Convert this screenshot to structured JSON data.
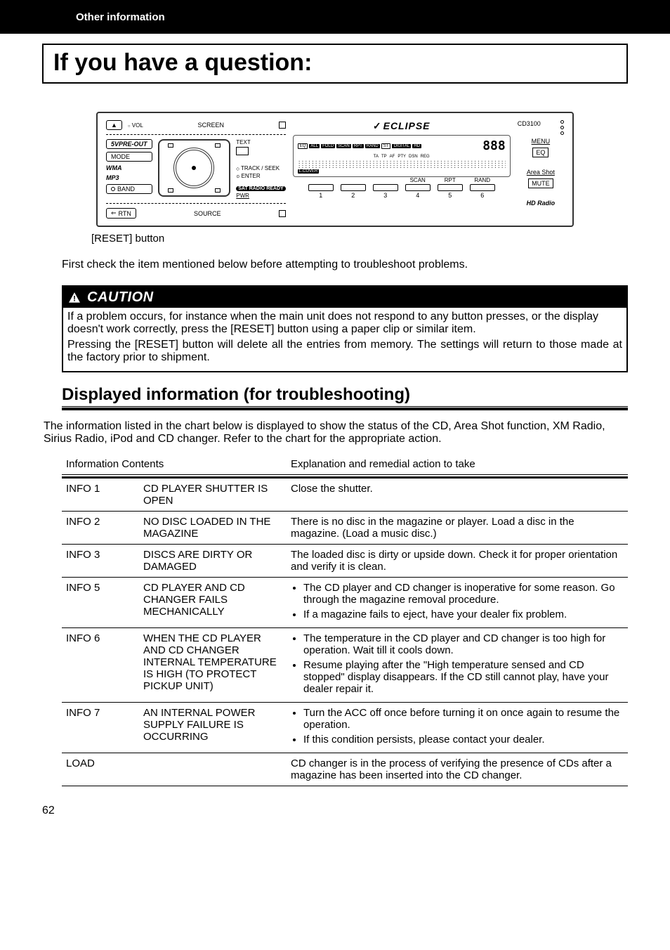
{
  "header": {
    "section": "Other information"
  },
  "title": "If you have a question:",
  "device": {
    "eject_icon": "▲",
    "vol": "VOL",
    "screen": "SCREEN",
    "text_btn": "TEXT",
    "preout": "5VPRE-OUT",
    "mode": "MODE",
    "wma": "WMA",
    "mp3": "MP3",
    "band": "BAND",
    "rtn": "RTN",
    "track_seek": "TRACK / SEEK",
    "enter": "ENTER",
    "pwr": "PWR",
    "source": "SOURCE",
    "sat_ready": "SAT RADIO READY",
    "brand": "ECLIPSE",
    "lcd_eq": "EQ",
    "lcd_flags": [
      "ALL",
      "FOLD",
      "SCAN",
      "RPT",
      "RAND",
      "ST",
      "DIGITAL",
      "HD"
    ],
    "lcd_sub": [
      "TA",
      "TP",
      "AF",
      "PTY",
      "DSN",
      "REG"
    ],
    "lcd_lcover": "L-COVER",
    "lcd_digits": "888",
    "model": "CD3100",
    "menu": "MENU",
    "eq": "EQ",
    "area_shot": "Area Shot",
    "mute": "MUTE",
    "hd_radio": "HD Radio",
    "buttons": [
      {
        "label": "",
        "num": "1"
      },
      {
        "label": "",
        "num": "2"
      },
      {
        "label": "",
        "num": "3"
      },
      {
        "label": "SCAN",
        "num": "4"
      },
      {
        "label": "RPT",
        "num": "5"
      },
      {
        "label": "RAND",
        "num": "6"
      }
    ]
  },
  "reset_label": "[RESET] button",
  "intro": "First check the item mentioned below before attempting to troubleshoot problems.",
  "caution": {
    "label": "CAUTION",
    "p1": "If a problem occurs, for instance when the main unit does not respond to any button presses, or the display doesn't work correctly, press the [RESET] button using a paper clip or similar item.",
    "p2": "Pressing the [RESET] button will delete all the entries from memory. The settings will return to those made at the factory prior to shipment."
  },
  "section_title": "Displayed information (for troubleshooting)",
  "table_intro": "The information listed in the chart below is displayed to show the status of the CD, Area Shot function, XM Radio, Sirius Radio, iPod and CD changer. Refer to the chart for the appropriate action.",
  "table": {
    "head_left": "Information Contents",
    "head_right": "Explanation and remedial action to take",
    "rows": [
      {
        "code": "INFO 1",
        "contents": "CD PLAYER SHUTTER IS OPEN",
        "actions": [
          "Close the shutter."
        ],
        "bulleted": false
      },
      {
        "code": "INFO 2",
        "contents": "NO DISC LOADED IN THE MAGAZINE",
        "actions": [
          "There is no disc in the magazine or player. Load a disc in the magazine. (Load a music disc.)"
        ],
        "bulleted": false
      },
      {
        "code": "INFO 3",
        "contents": "DISCS ARE DIRTY OR DAMAGED",
        "actions": [
          "The loaded disc is dirty or upside down. Check it for proper orientation and verify it is clean."
        ],
        "bulleted": false
      },
      {
        "code": "INFO 5",
        "contents": "CD PLAYER AND CD CHANGER FAILS MECHANICALLY",
        "actions": [
          "The CD player and CD changer is inoperative for some reason. Go through the magazine removal procedure.",
          "If a magazine fails to eject, have your dealer fix problem."
        ],
        "bulleted": true
      },
      {
        "code": "INFO 6",
        "contents": "WHEN THE CD PLAYER AND CD CHANGER INTERNAL TEMPERATURE IS HIGH (TO PROTECT PICKUP UNIT)",
        "actions": [
          "The temperature in the CD player and CD changer is too high for operation. Wait till it cools down.",
          "Resume playing after the \"High temperature sensed and CD stopped\" display disappears. If the CD still cannot play, have your dealer repair it."
        ],
        "bulleted": true
      },
      {
        "code": "INFO 7",
        "contents": "AN INTERNAL POWER SUPPLY FAILURE IS OCCURRING",
        "actions": [
          "Turn the ACC off once before turning it on once again to resume the operation.",
          "If this condition persists, please contact your dealer."
        ],
        "bulleted": true
      },
      {
        "code": "LOAD",
        "contents": "",
        "actions": [
          "CD changer is in the process of verifying the presence of CDs after a magazine has been inserted into the CD changer."
        ],
        "bulleted": false
      }
    ]
  },
  "page_number": "62"
}
